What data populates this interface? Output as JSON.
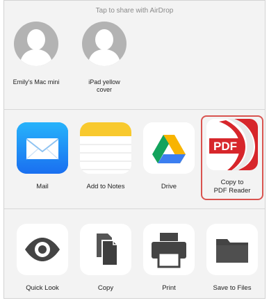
{
  "airdrop": {
    "title": "Tap to share with AirDrop",
    "contacts": [
      {
        "label": "Emily's Mac mini"
      },
      {
        "label_line1": "iPad yellow",
        "label_line2": "cover"
      }
    ]
  },
  "apps": [
    {
      "label": "Mail",
      "icon": "mail-icon"
    },
    {
      "label": "Add to Notes",
      "icon": "notes-icon"
    },
    {
      "label": "Drive",
      "icon": "drive-icon"
    },
    {
      "label_line1": "Copy to",
      "label_line2": "PDF Reader",
      "icon": "pdf-reader-icon",
      "icon_text": "PDF",
      "highlighted": true
    }
  ],
  "actions": [
    {
      "label": "Quick Look",
      "icon": "eye-icon"
    },
    {
      "label": "Copy",
      "icon": "copy-icon"
    },
    {
      "label": "Print",
      "icon": "printer-icon"
    },
    {
      "label": "Save to Files",
      "icon": "folder-icon"
    }
  ],
  "colors": {
    "mail_blue": "#1e8af5",
    "notes_yellow": "#f8c92e",
    "pdf_red": "#d7262b",
    "highlight": "#d9534f"
  }
}
